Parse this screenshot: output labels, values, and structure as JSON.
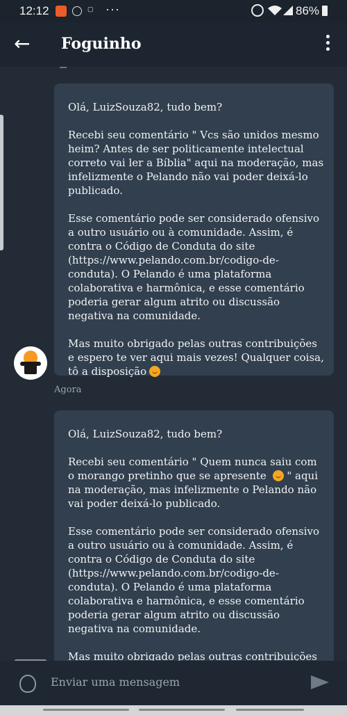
{
  "status_bar": {
    "time": "12:12",
    "battery": "86%",
    "icons": [
      "notification-orange-icon",
      "circle-app-icon",
      "small-logo-icon",
      "more-dots-icon",
      "alarm-icon",
      "wifi-icon",
      "signal-icon",
      "battery-icon"
    ]
  },
  "header": {
    "title": "Foguinho"
  },
  "messages": [
    {
      "text": "Olá, LuizSouza82, tudo bem?\n\nRecebi seu comentário \" Vcs são unidos mesmo heim? Antes de ser politicamente intelectual correto vai ler a Bíblia\" aqui na moderação, mas infelizmente o Pelando não vai poder deixá-lo publicado.\n\nEsse comentário pode ser considerado ofensivo a outro usuário ou à comunidade. Assim, é contra o Código de Conduta do site (https://www.pelando.com.br/codigo-de-conduta). O Pelando é uma plataforma colaborativa e harmônica, e esse comentário poderia gerar algum atrito ou discussão negativa na comunidade.\n\nMas muito obrigado pelas outras contribuições e espero te ver aqui mais vezes! Qualquer coisa, tô a disposição",
      "timestamp": "Agora"
    },
    {
      "text_before_emoji": "Olá, LuizSouza82, tudo bem?\n\nRecebi seu comentário \" Quem nunca saiu com o morango pretinho que se apresente ",
      "text_after_emoji": " \" aqui na moderação, mas infelizmente o Pelando não vai poder deixá-lo publicado.\n\nEsse comentário pode ser considerado ofensivo a outro usuário ou à comunidade. Assim, é contra o Código de Conduta do site (https://www.pelando.com.br/codigo-de-conduta). O Pelando é uma plataforma colaborativa e harmônica, e esse comentário poderia gerar algum atrito ou discussão negativa na comunidade.\n\nMas muito obrigado pelas outras contribuições e espero te ver aqui mais vezes! Qualquer coisa, tô"
    }
  ],
  "composer": {
    "placeholder": "Enviar uma mensagem"
  },
  "colors": {
    "background": "#222b36",
    "bubble": "#313f4e",
    "accent_flame": "#f59a23"
  }
}
